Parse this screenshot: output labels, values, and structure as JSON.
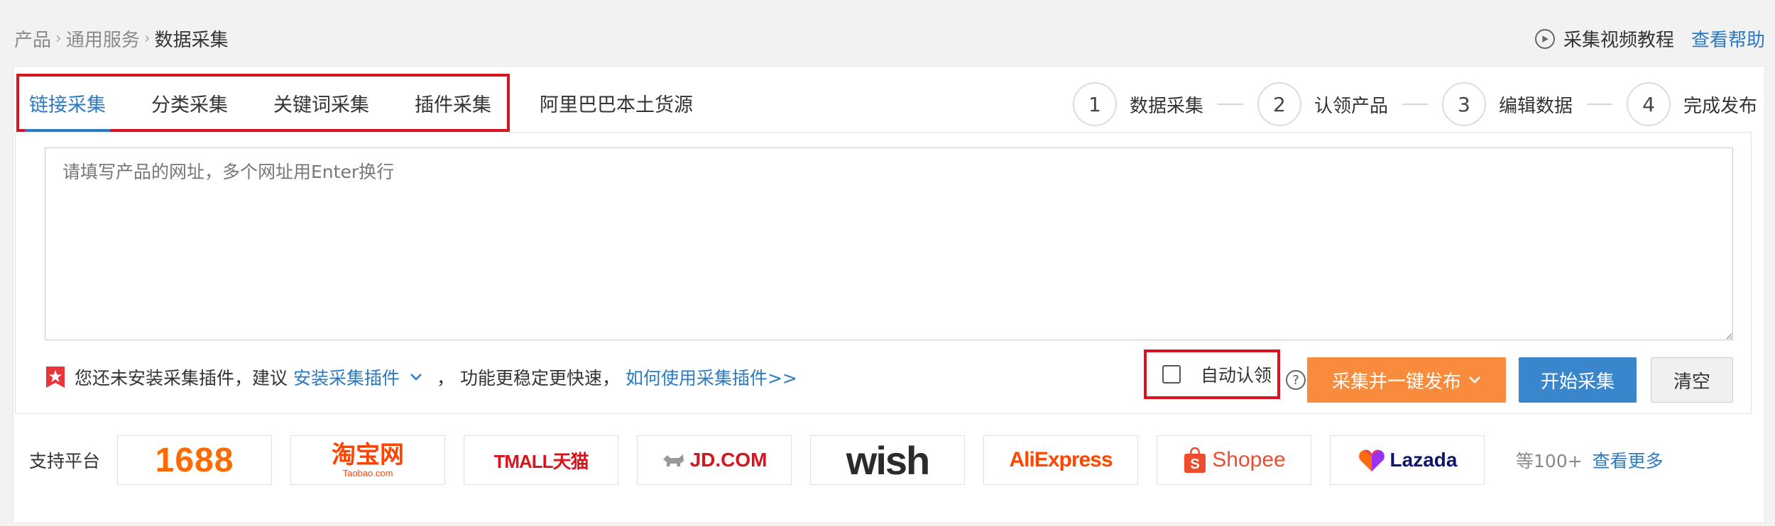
{
  "breadcrumb": {
    "items": [
      "产品",
      "通用服务"
    ],
    "current": "数据采集"
  },
  "help": {
    "video_label": "采集视频教程",
    "help_link": "查看帮助"
  },
  "tabs": [
    {
      "label": "链接采集",
      "active": true
    },
    {
      "label": "分类采集"
    },
    {
      "label": "关键词采集"
    },
    {
      "label": "插件采集"
    },
    {
      "label": "阿里巴巴本土货源"
    }
  ],
  "steps": [
    {
      "num": "1",
      "label": "数据采集"
    },
    {
      "num": "2",
      "label": "认领产品"
    },
    {
      "num": "3",
      "label": "编辑数据"
    },
    {
      "num": "4",
      "label": "完成发布"
    }
  ],
  "url_input": {
    "placeholder": "请填写产品的网址，多个网址用Enter换行",
    "value": ""
  },
  "hint": {
    "text1": "您还未安装采集插件，建议",
    "install_link": "安装采集插件",
    "text2": "，  功能更稳定更快速，",
    "howto_link": "如何使用采集插件>>"
  },
  "actions": {
    "auto_claim": "自动认领",
    "auto_claim_checked": false,
    "collect_publish": "采集并一键发布",
    "start": "开始采集",
    "clear": "清空"
  },
  "platforms": {
    "label": "支持平台",
    "logos": {
      "p1688": "1688",
      "taobao": "淘宝网",
      "taobao_sub": "Taobao.com",
      "tmall": "TMALL天猫",
      "jd": "JD.COM",
      "wish": "wish",
      "aliexpress": "AliExpress",
      "shopee": "Shopee",
      "lazada": "Lazada"
    },
    "more_text": "等100+",
    "more_link": "查看更多"
  },
  "colors": {
    "link_blue": "#2a7ac4",
    "highlight_red": "#d9141e",
    "orange_button": "#f98b3c",
    "blue_button": "#3a86cc"
  }
}
